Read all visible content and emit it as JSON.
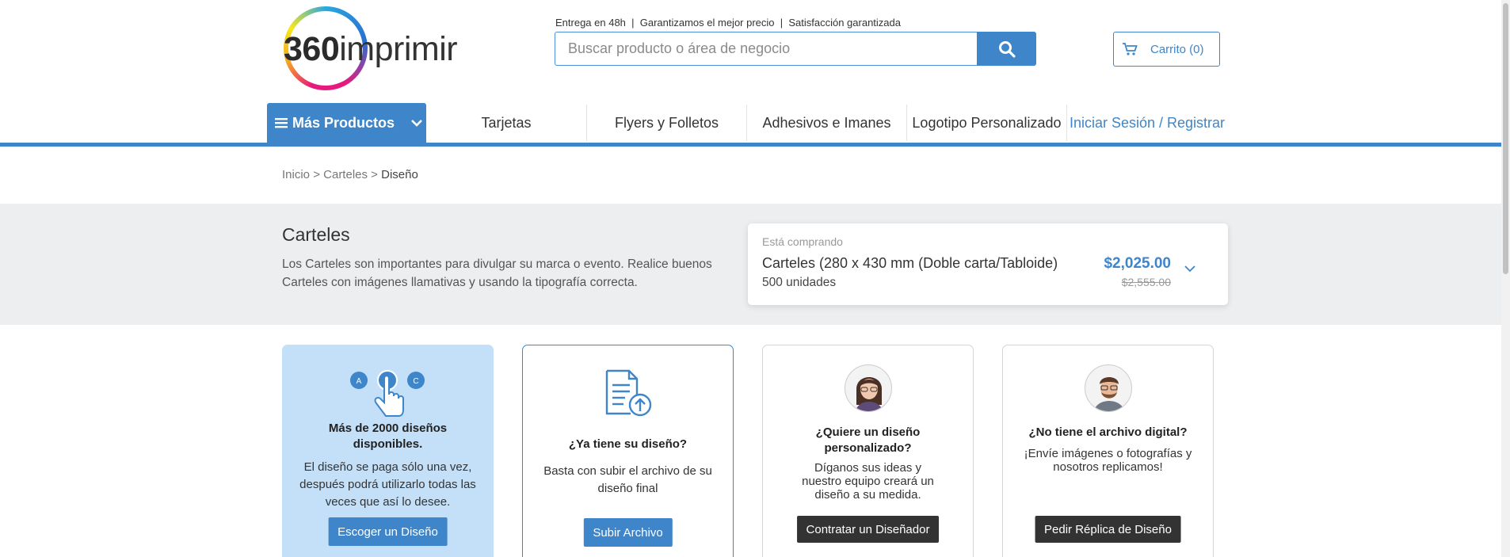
{
  "header": {
    "logo_prefix": "360",
    "logo_suffix": "imprimir",
    "tagline": "Entrega en 48h  |  Garantizamos el mejor precio  |  Satisfacción garantizada",
    "search_placeholder": "Buscar producto o área de negocio",
    "cart_label": "Carrito (0)"
  },
  "nav": {
    "more_label": "Más Productos",
    "items": [
      "Tarjetas",
      "Flyers y Folletos",
      "Adhesivos e Imanes",
      "Logotipo Personalizado"
    ],
    "login_label": "Iniciar Sesión / Registrar"
  },
  "breadcrumb": {
    "home": "Inicio",
    "sep": ">",
    "category": "Carteles",
    "current": "Diseño"
  },
  "product": {
    "title": "Carteles",
    "description": "Los Carteles son importantes para divulgar su marca o evento. Realice buenos Carteles con imágenes llamativas y usando la tipografía correcta.",
    "buying_label": "Está comprando",
    "name": "Carteles (280 x 430 mm (Doble carta/Tabloide)",
    "quantity": "500 unidades",
    "price": "$2,025.00",
    "old_price": "$2,555.00"
  },
  "options": [
    {
      "icon": "choose-design-icon",
      "icon_letters": [
        "A",
        "B",
        "C"
      ],
      "title": "Más de 2000 diseños disponibles.",
      "text": "El diseño se paga sólo una vez, después podrá utilizarlo todas las veces que así lo desee.",
      "button": "Escoger un Diseño"
    },
    {
      "icon": "upload-document-icon",
      "title": "¿Ya tiene su diseño?",
      "text": "Basta con subir el archivo de su diseño final",
      "button": "Subir Archivo"
    },
    {
      "icon": "designer-avatar-woman",
      "title": "¿Quiere un diseño personalizado?",
      "text": "Díganos sus ideas y nuestro equipo creará un diseño a su medida.",
      "button": "Contratar un Diseñador"
    },
    {
      "icon": "designer-avatar-man",
      "title": "¿No tiene el archivo digital?",
      "text": "¡Envíe imágenes o fotografías y nosotros replicamos!",
      "button": "Pedir Réplica de Diseño"
    }
  ],
  "colors": {
    "accent": "#3f85c9",
    "band": "#eceeef",
    "card_highlight": "#c4e0f8",
    "dark_button": "#333333"
  }
}
